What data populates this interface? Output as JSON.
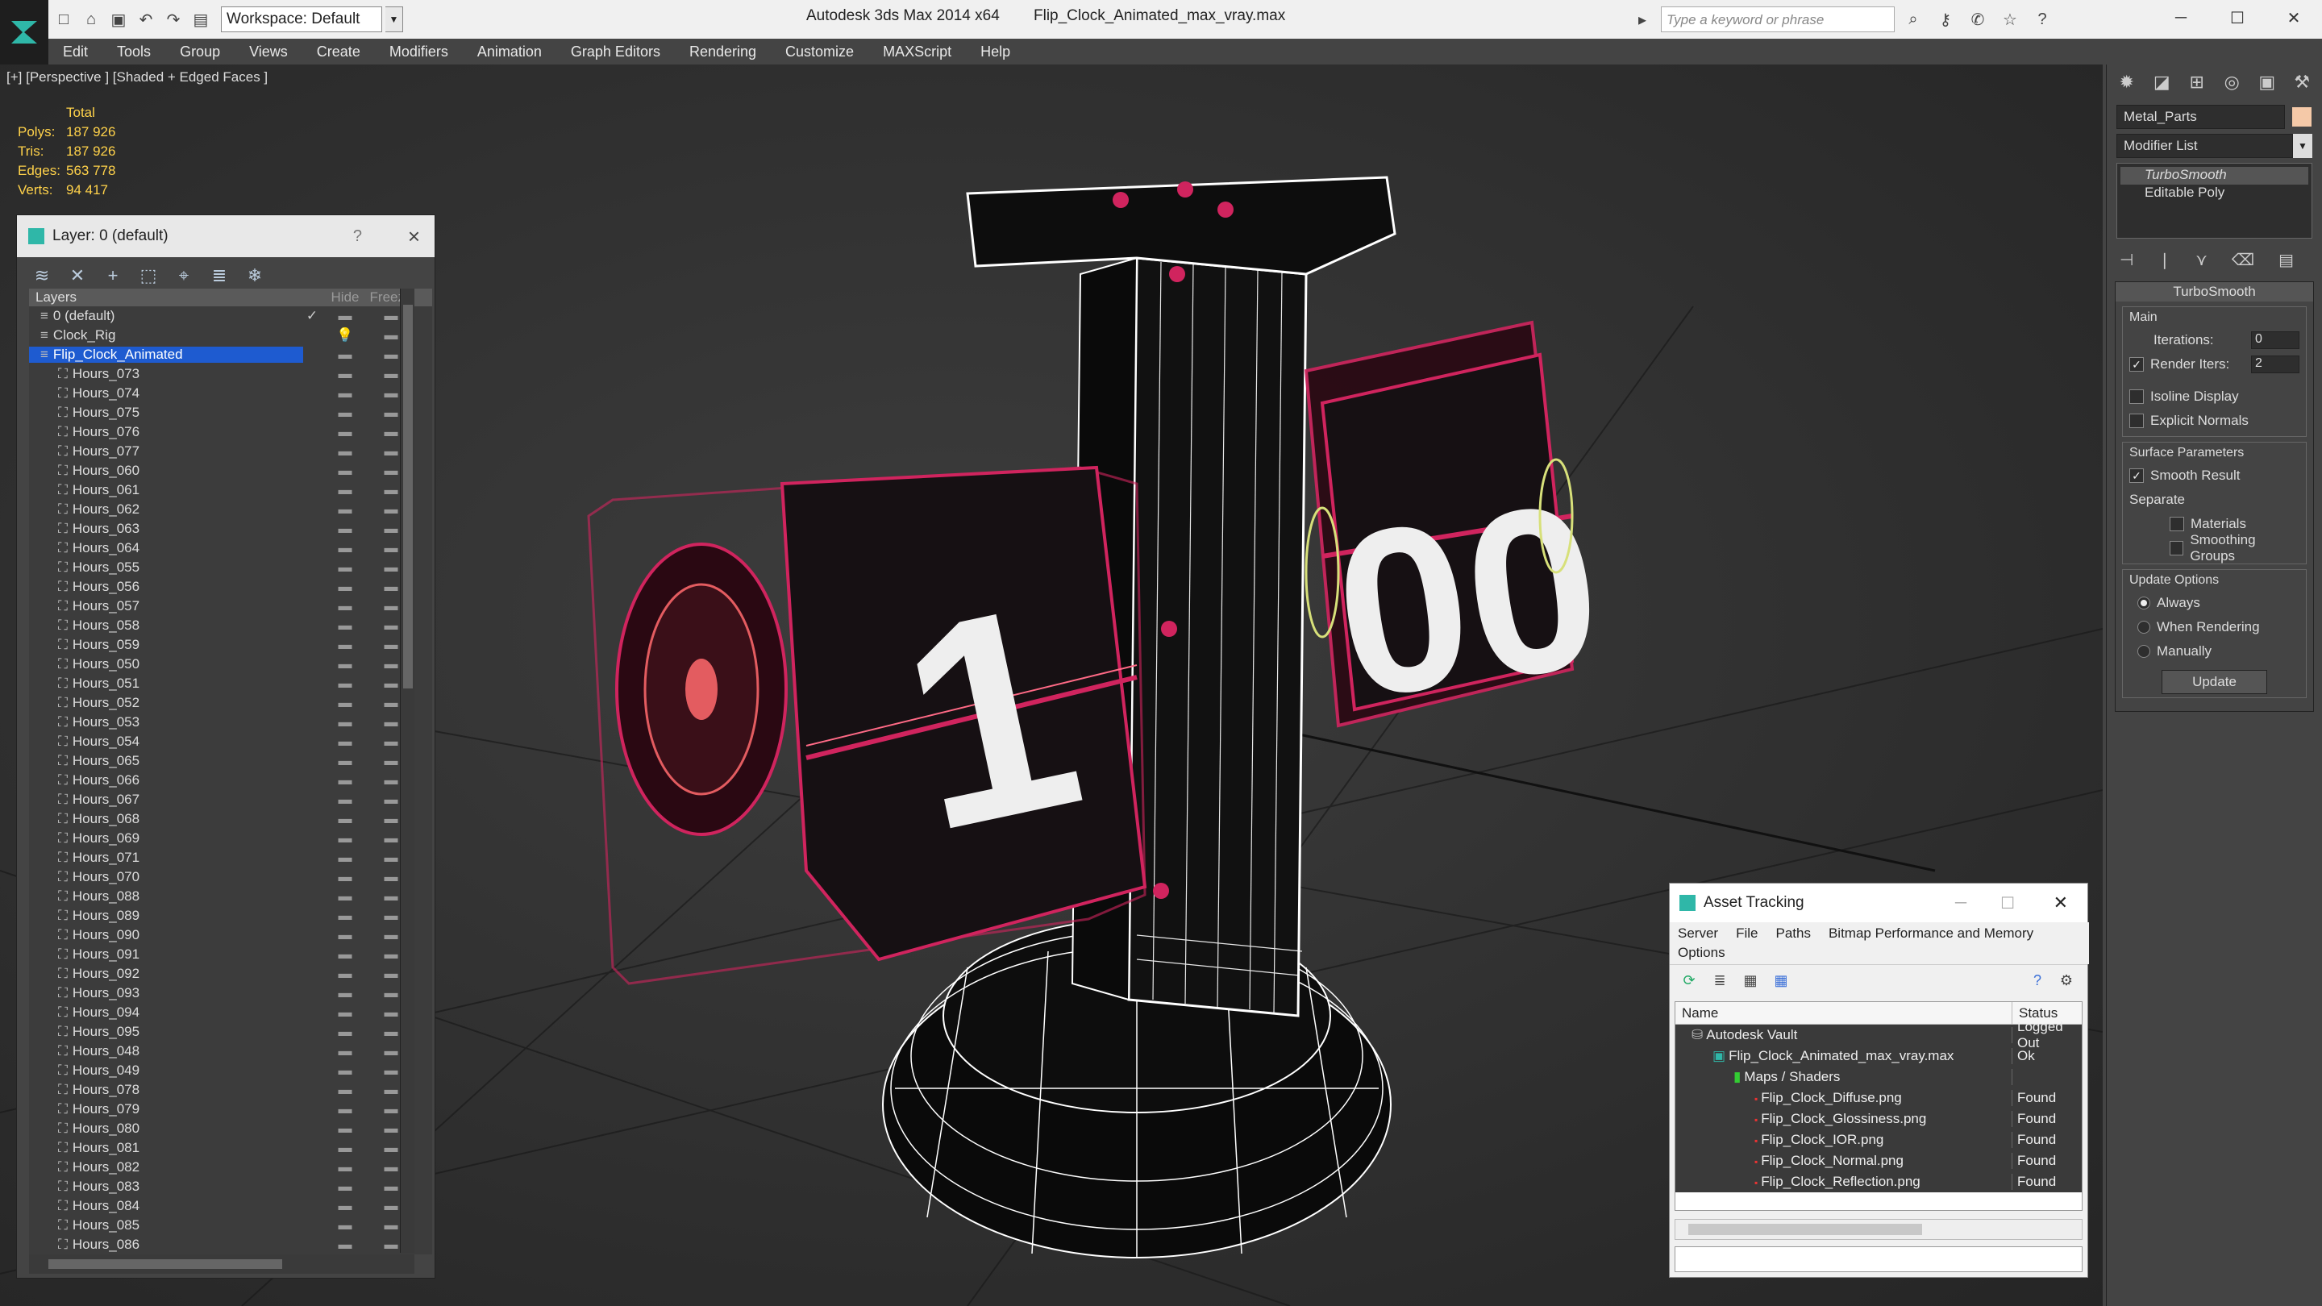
{
  "app": {
    "title": "Autodesk 3ds Max 2014 x64",
    "file": "Flip_Clock_Animated_max_vray.max",
    "workspace": "Workspace: Default",
    "search_placeholder": "Type a keyword or phrase"
  },
  "menu": [
    "Edit",
    "Tools",
    "Group",
    "Views",
    "Create",
    "Modifiers",
    "Animation",
    "Graph Editors",
    "Rendering",
    "Customize",
    "MAXScript",
    "Help"
  ],
  "viewport": {
    "label": "[+] [Perspective ] [Shaded + Edged Faces ]",
    "stats": {
      "header": "Total",
      "rows": [
        {
          "k": "Polys:",
          "v": "187 926"
        },
        {
          "k": "Tris:",
          "v": "187 926"
        },
        {
          "k": "Edges:",
          "v": "563 778"
        },
        {
          "k": "Verts:",
          "v": "94 417"
        }
      ]
    }
  },
  "layer_panel": {
    "title": "Layer: 0 (default)",
    "help": "?",
    "cols": {
      "layers": "Layers",
      "hide": "Hide",
      "freeze": "Freeze"
    },
    "rows": [
      {
        "name": "0 (default)",
        "check": "✓"
      },
      {
        "name": "Clock_Rig"
      },
      {
        "name": "Flip_Clock_Animated",
        "selected": true
      },
      {
        "name": "Hours_073"
      },
      {
        "name": "Hours_074"
      },
      {
        "name": "Hours_075"
      },
      {
        "name": "Hours_076"
      },
      {
        "name": "Hours_077"
      },
      {
        "name": "Hours_060"
      },
      {
        "name": "Hours_061"
      },
      {
        "name": "Hours_062"
      },
      {
        "name": "Hours_063"
      },
      {
        "name": "Hours_064"
      },
      {
        "name": "Hours_055"
      },
      {
        "name": "Hours_056"
      },
      {
        "name": "Hours_057"
      },
      {
        "name": "Hours_058"
      },
      {
        "name": "Hours_059"
      },
      {
        "name": "Hours_050"
      },
      {
        "name": "Hours_051"
      },
      {
        "name": "Hours_052"
      },
      {
        "name": "Hours_053"
      },
      {
        "name": "Hours_054"
      },
      {
        "name": "Hours_065"
      },
      {
        "name": "Hours_066"
      },
      {
        "name": "Hours_067"
      },
      {
        "name": "Hours_068"
      },
      {
        "name": "Hours_069"
      },
      {
        "name": "Hours_071"
      },
      {
        "name": "Hours_070"
      },
      {
        "name": "Hours_088"
      },
      {
        "name": "Hours_089"
      },
      {
        "name": "Hours_090"
      },
      {
        "name": "Hours_091"
      },
      {
        "name": "Hours_092"
      },
      {
        "name": "Hours_093"
      },
      {
        "name": "Hours_094"
      },
      {
        "name": "Hours_095"
      },
      {
        "name": "Hours_048"
      },
      {
        "name": "Hours_049"
      },
      {
        "name": "Hours_078"
      },
      {
        "name": "Hours_079"
      },
      {
        "name": "Hours_080"
      },
      {
        "name": "Hours_081"
      },
      {
        "name": "Hours_082"
      },
      {
        "name": "Hours_083"
      },
      {
        "name": "Hours_084"
      },
      {
        "name": "Hours_085"
      },
      {
        "name": "Hours_086"
      }
    ]
  },
  "command_panel": {
    "object_name": "Metal_Parts",
    "modifier_list": "Modifier List",
    "stack": [
      "TurboSmooth",
      "Editable Poly"
    ],
    "rollout": "TurboSmooth",
    "main_label": "Main",
    "iterations_label": "Iterations:",
    "iterations": "0",
    "render_iters_label": "Render Iters:",
    "render_iters": "2",
    "isoline": "Isoline Display",
    "explicit": "Explicit Normals",
    "surface_label": "Surface Parameters",
    "smooth_result": "Smooth Result",
    "separate": "Separate",
    "materials": "Materials",
    "smoothing_groups": "Smoothing Groups",
    "update_label": "Update Options",
    "always": "Always",
    "when_rendering": "When Rendering",
    "manually": "Manually",
    "update_btn": "Update"
  },
  "asset_tracking": {
    "title": "Asset Tracking",
    "menu": [
      "Server",
      "File",
      "Paths",
      "Bitmap Performance and Memory",
      "Options"
    ],
    "cols": {
      "name": "Name",
      "status": "Status"
    },
    "rows": [
      {
        "name": "Autodesk Vault",
        "status": "Logged Out",
        "indent": 0
      },
      {
        "name": "Flip_Clock_Animated_max_vray.max",
        "status": "Ok",
        "indent": 1
      },
      {
        "name": "Maps / Shaders",
        "status": "",
        "indent": 2
      },
      {
        "name": "Flip_Clock_Diffuse.png",
        "status": "Found",
        "indent": 3
      },
      {
        "name": "Flip_Clock_Glossiness.png",
        "status": "Found",
        "indent": 3
      },
      {
        "name": "Flip_Clock_IOR.png",
        "status": "Found",
        "indent": 3
      },
      {
        "name": "Flip_Clock_Normal.png",
        "status": "Found",
        "indent": 3
      },
      {
        "name": "Flip_Clock_Reflection.png",
        "status": "Found",
        "indent": 3
      }
    ]
  },
  "clock": {
    "hour": "1",
    "minutes": "00"
  }
}
